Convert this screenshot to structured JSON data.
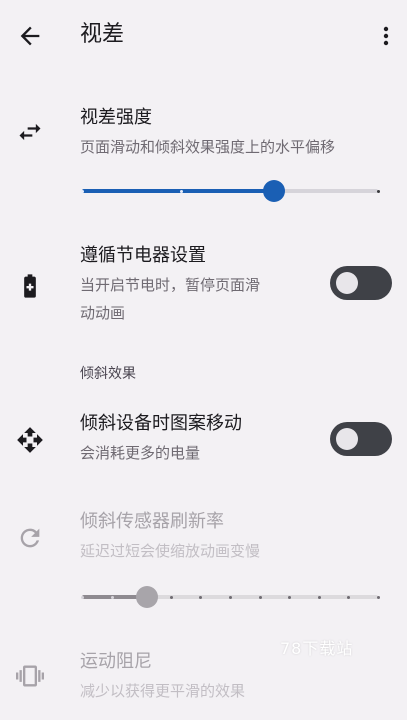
{
  "appbar": {
    "title": "视差"
  },
  "parallax_strength": {
    "label": "视差强度",
    "desc": "页面滑动和倾斜效果强度上的水平偏移",
    "value_fraction": 0.65,
    "accent": "#1a5fb4"
  },
  "battery_saver": {
    "label": "遵循节电器设置",
    "desc_line1": "当开启节电时，暂停页面滑",
    "desc_line2": "动动画",
    "on": false
  },
  "section_tilt": {
    "label": "倾斜效果"
  },
  "tilt_move": {
    "label": "倾斜设备时图案移动",
    "desc": "会消耗更多的电量",
    "on": false
  },
  "sensor_rate": {
    "label": "倾斜传感器刷新率",
    "desc": "延迟过短会使缩放动画变慢",
    "value_fraction": 0.22,
    "enabled": false
  },
  "damping": {
    "label": "运动阻尼",
    "desc": "减少以获得更平滑的效果",
    "enabled": false
  },
  "watermark": {
    "text": "78下载站"
  },
  "icons": [
    "back-arrow-icon",
    "more-vert-icon",
    "swap-horiz-icon",
    "battery-saver-icon",
    "move-arrows-icon",
    "refresh-icon",
    "vibrate-icon"
  ]
}
